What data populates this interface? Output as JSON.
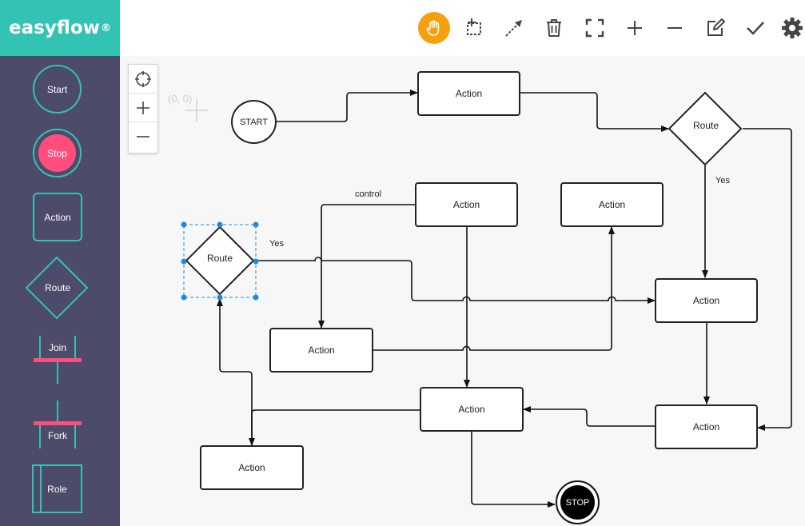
{
  "app": {
    "name": "easyflow",
    "registered": "®"
  },
  "palette": [
    {
      "key": "start",
      "label": "Start"
    },
    {
      "key": "stop",
      "label": "Stop"
    },
    {
      "key": "action",
      "label": "Action"
    },
    {
      "key": "route",
      "label": "Route"
    },
    {
      "key": "join",
      "label": "Join"
    },
    {
      "key": "fork",
      "label": "Fork"
    },
    {
      "key": "role",
      "label": "Role"
    }
  ],
  "toolbar": {
    "tools": [
      "hand-icon",
      "select-area-icon",
      "connect-icon",
      "trash-icon",
      "fullscreen-icon",
      "zoom-in-icon",
      "zoom-out-icon",
      "edit-icon",
      "check-icon",
      "gear-icon"
    ],
    "active": "hand-icon",
    "active_color": "#f5a00e"
  },
  "canvas": {
    "origin_label": "(0, 0)",
    "zoom_controls": [
      "locate-icon",
      "zoom-in-icon",
      "zoom-out-icon"
    ]
  },
  "diagram": {
    "nodes": {
      "start": "START",
      "stop": "STOP",
      "action_top": "Action",
      "route_top": "Route",
      "action_mid_center": "Action",
      "action_mid_right": "Action",
      "route_selected": "Route",
      "action_left": "Action",
      "action_right": "Action",
      "action_center_bottom": "Action",
      "action_right_bottom": "Action",
      "action_bottom_left": "Action"
    },
    "edge_labels": {
      "control": "control",
      "yes_left": "Yes",
      "yes_right": "Yes"
    }
  },
  "colors": {
    "sidebar": "#4c4b6a",
    "brand": "#32c3b4",
    "stop_fill": "#ff4d7d",
    "fork_bar": "#ff4d7d",
    "selection": "#1e88e5"
  }
}
